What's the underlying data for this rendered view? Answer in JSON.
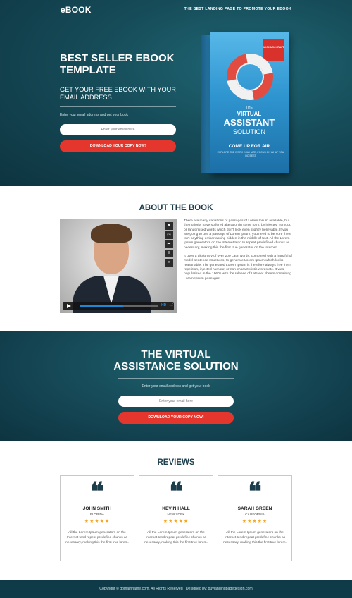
{
  "header": {
    "logo": "eBOOK",
    "tagline": "THE BEST LANDING PAGE TO PROMOTE YOUR EBOOK"
  },
  "hero": {
    "title": "BEST SELLER EBOOK TEMPLATE",
    "subtitle": "GET YOUR FREE EBOOK WITH YOUR EMAIL ADDRESS",
    "hint": "Enter your email address and get your book",
    "email_placeholder": "Enter your email here",
    "button_label": "DOWNLOAD YOUR COPY NOW!"
  },
  "book": {
    "badge": "MICHAEL KRAFT",
    "the": "THE",
    "title_line1": "VIRTUAL",
    "title_line2": "ASSISTANT",
    "title_line3": "SOLUTION",
    "come_up": "COME UP FOR AIR",
    "small_text": "EXPLORE THE WORK YOU HATE, FOCUS ON WHAT YOU DO BEST"
  },
  "about": {
    "title": "ABOUT THE BOOK",
    "video": {
      "side_icons": [
        "heart-icon",
        "clock-icon",
        "share-icon",
        "more-icon",
        "embed-icon"
      ],
      "progress": 0.55,
      "quality_label": "HD"
    },
    "paragraphs": [
      "There are many variations of passages of Lorem Ipsum available, but the majority have suffered alteration in some form, by injected humour, or randomised words which don't look even slightly believable. If you are going to use a passage of Lorem Ipsum, you need to be sure there isn't anything embarrassing hidden in the middle of text. All the Lorem Ipsum generators on the Internet tend to repeat predefined chunks as necessary, making this the first true generator on the Internet.",
      "It uses a dictionary of over 200 Latin words, combined with a handful of model sentence structures, to generate Lorem Ipsum which looks reasonable. The generated Lorem Ipsum is therefore always free from repetition, injected humour, or non-characteristic words etc. It was popularised in the 1960s with the release of Letraset sheets containing Lorem Ipsum passages."
    ]
  },
  "virtual": {
    "title_line1": "THE VIRTUAL",
    "title_line2": "ASSISTANCE SOLUTION",
    "hint": "Enter your email address and get your book",
    "email_placeholder": "Enter your email here",
    "button_label": "DOWNLOAD YOUR COPY NOW!"
  },
  "reviews": {
    "title": "REVIEWS",
    "items": [
      {
        "name": "JOHN SMITH",
        "location": "FLORIDA",
        "stars": "★★★★★",
        "text": "All the Lorem Ipsum generators on the Internet tend repeat predefine chunks as necessary, making this the first true lorem."
      },
      {
        "name": "KEVIN HALL",
        "location": "NEW YORK",
        "stars": "★★★★★",
        "text": "All the Lorem Ipsum generators on the Internet tend repeat predefine chunks as necessary, making this the first true lorem."
      },
      {
        "name": "SARAH GREEN",
        "location": "CALIFORNIA",
        "stars": "★★★★★",
        "text": "All the Lorem Ipsum generators on the Internet tend repeat predefine chunks as necessary, making this the first true lorem."
      }
    ]
  },
  "footer": {
    "text": "Copyright © domainname.com. All Rights Reserved  |  Designed by: buylandingpagedesign.com"
  },
  "colors": {
    "hero_bg": "#164b58",
    "accent_red": "#e5362d",
    "heading_dark": "#1c3d4c",
    "star": "#f5a623",
    "footer_bg": "#0f3a47"
  }
}
